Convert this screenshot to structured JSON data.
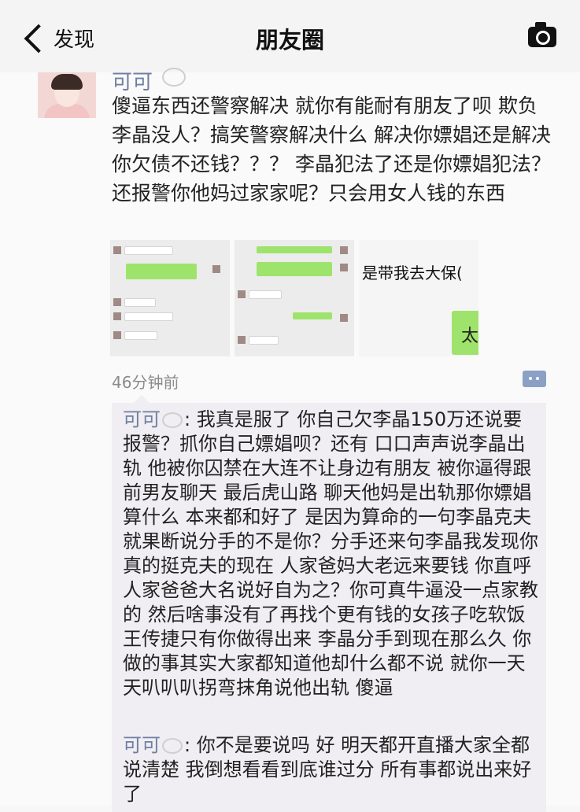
{
  "nav": {
    "back_label": "发现",
    "title": "朋友圈"
  },
  "post": {
    "username": "可可",
    "text": "傻逼东西还警察解决 就你有能耐有朋友了呗 欺负李晶没人？搞笑警察解决什么 解决你嫖娼还是解决你欠债不还钱？？？ 李晶犯法了还是你嫖娼犯法？还报警你他妈过家家呢？只会用女人钱的东西",
    "image3_text": "是带我去大保(",
    "image3_green_char": "太",
    "time": "46分钟前"
  },
  "comments": [
    {
      "name": "可可",
      "text": ": 我真是服了 你自己欠李晶150万还说要报警？抓你自己嫖娼呗？还有 口口声声说李晶出轨 他被你囚禁在大连不让身边有朋友 被你逼得跟前男友聊天 最后虎山路 聊天他妈是出轨那你嫖娼算什么 本来都和好了 是因为算命的一句李晶克夫就果断说分手的不是你？分手还来句李晶我发现你真的挺克夫的现在 人家爸妈大老远来要钱 你直呼人家爸爸大名说好自为之？你可真牛逼没一点家教的  然后啥事没有了再找个更有钱的女孩子吃软饭 王传捷只有你做得出来 李晶分手到现在那么久 你做的事其实大家都知道他却什么都不说 就你一天天叭叭叭拐弯抹角说他出轨 傻逼"
    },
    {
      "name": "可可",
      "text": ": 你不是要说吗 好 明天都开直播大家全都说清楚 我倒想看看到底谁过分 所有事都说出来好了"
    }
  ],
  "icons": [
    "back-chevron-icon",
    "camera-icon",
    "comment-icon"
  ]
}
